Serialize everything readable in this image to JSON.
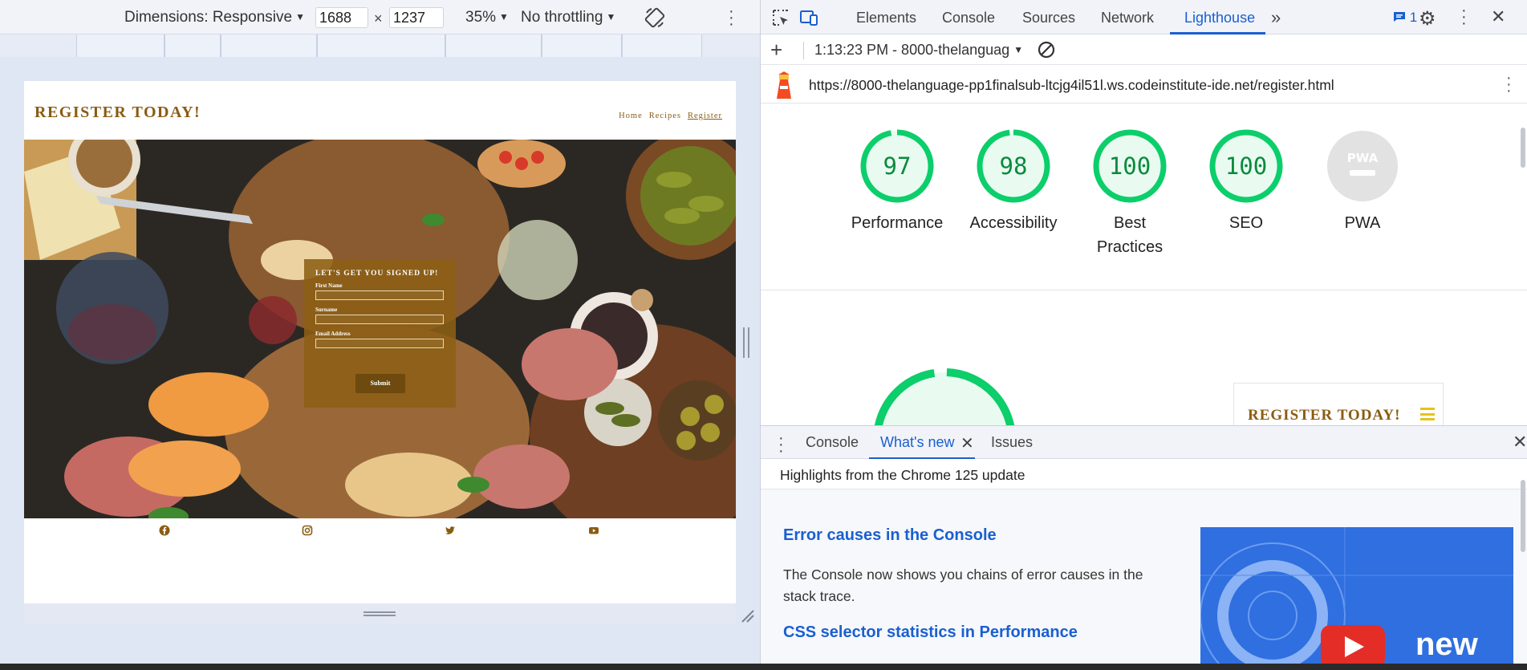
{
  "device_toolbar": {
    "dimensions_label": "Dimensions: Responsive",
    "width_value": "1688",
    "times": "×",
    "height_value": "1237",
    "zoom": "35%",
    "throttling": "No throttling"
  },
  "site": {
    "title": "REGISTER TODAY!",
    "nav": [
      "Home",
      "Recipes",
      "Register"
    ],
    "form": {
      "heading": "LET'S GET YOU SIGNED UP!",
      "fields": [
        "First Name",
        "Surname",
        "Email Address"
      ],
      "submit_label": "Submit"
    },
    "footer_icons": [
      "facebook-icon",
      "instagram-icon",
      "twitter-icon",
      "youtube-icon"
    ]
  },
  "devtools": {
    "tabs": [
      "Elements",
      "Console",
      "Sources",
      "Network",
      "Lighthouse"
    ],
    "active_tab": "Lighthouse",
    "issues_count": "1",
    "lighthouse": {
      "report_select": "1:13:23 PM - 8000-thelanguag",
      "url": "https://8000-thelanguage-pp1finalsub-ltcjg4il51l.ws.codeinstitute-ide.net/register.html",
      "scores": [
        {
          "label_lines": [
            "Performance"
          ],
          "value": "97"
        },
        {
          "label_lines": [
            "Accessibility"
          ],
          "value": "98"
        },
        {
          "label_lines": [
            "Best",
            "Practices"
          ],
          "value": "100"
        },
        {
          "label_lines": [
            "SEO"
          ],
          "value": "100"
        },
        {
          "label_lines": [
            "PWA"
          ],
          "value": "PWA"
        }
      ],
      "preview_title": "REGISTER TODAY!"
    },
    "drawer": {
      "tabs": [
        "Console",
        "What's new",
        "Issues"
      ],
      "active_tab": "What's new",
      "highlights_title": "Highlights from the Chrome 125 update",
      "articles": [
        {
          "title": "Error causes in the Console",
          "body": "The Console now shows you chains of error causes in the stack trace."
        },
        {
          "title": "CSS selector statistics in Performance"
        }
      ],
      "thumbnail_text": "new"
    }
  },
  "colors": {
    "brand_brown": "#8a5c12",
    "score_green": "#0cce6b",
    "devtools_blue": "#1a5fd0"
  }
}
